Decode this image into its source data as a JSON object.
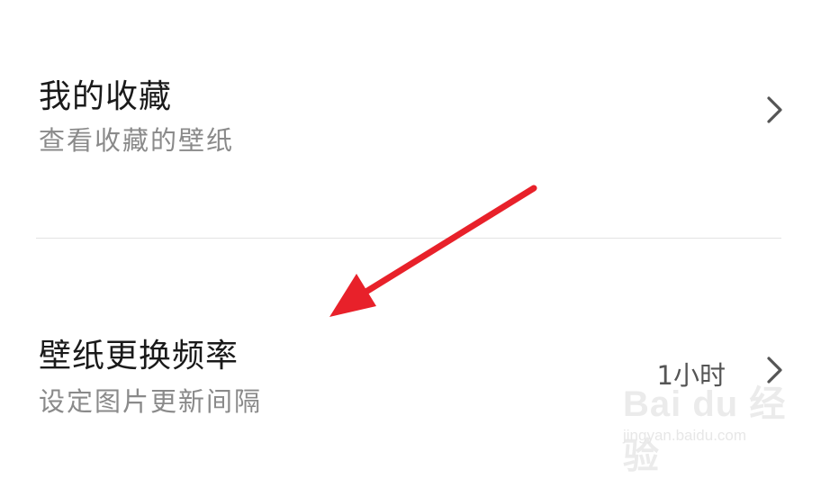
{
  "favorites": {
    "title": "我的收藏",
    "subtitle": "查看收藏的壁纸"
  },
  "wallpaper_frequency": {
    "title": "壁纸更换频率",
    "subtitle": "设定图片更新间隔",
    "value": "1小时"
  },
  "annotation": {
    "arrow_color": "#e8212a"
  },
  "watermark": {
    "logo_text": "Bai du 经验",
    "url": "jingyan.baidu.com"
  },
  "icons": {
    "chevron": "chevron-right-icon"
  }
}
